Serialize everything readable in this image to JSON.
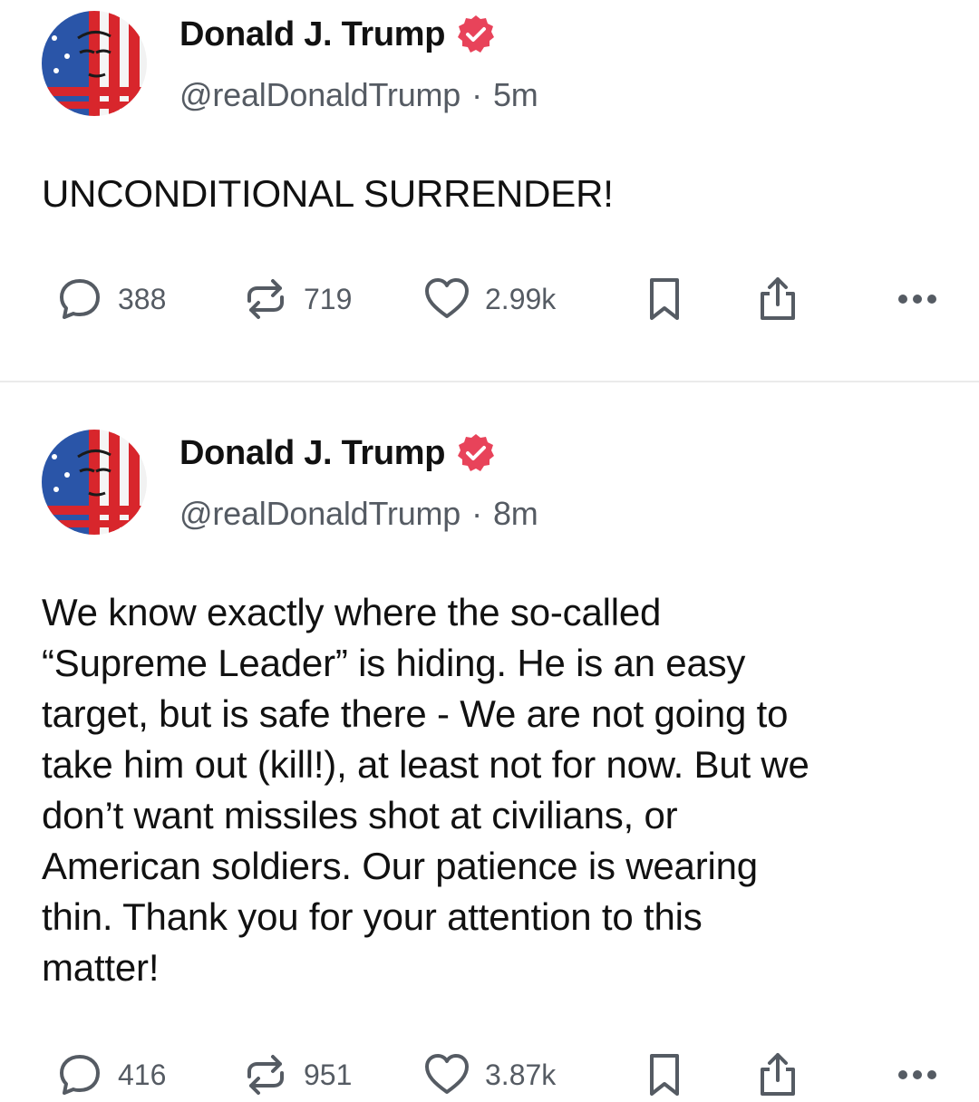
{
  "posts": [
    {
      "author": {
        "name": "Donald J. Trump",
        "handle": "@realDonaldTrump",
        "verified": true,
        "avatar_icon": "flag-portrait-avatar"
      },
      "time_separator": "·",
      "time": "5m",
      "text": "UNCONDITIONAL SURRENDER!",
      "stats": {
        "replies": "388",
        "retruths": "719",
        "likes": "2.99k"
      }
    },
    {
      "author": {
        "name": "Donald J. Trump",
        "handle": "@realDonaldTrump",
        "verified": true,
        "avatar_icon": "flag-portrait-avatar"
      },
      "time_separator": "·",
      "time": "8m",
      "text": "We know exactly where the so-called\n“Supreme Leader” is hiding. He is an easy\ntarget, but is safe there - We are not going to\ntake him out (kill!), at least not for now. But we\ndon’t want missiles shot at civilians, or\nAmerican soldiers. Our patience is wearing\nthin. Thank you for your attention to this\nmatter!",
      "stats": {
        "replies": "416",
        "retruths": "951",
        "likes": "3.87k"
      }
    }
  ],
  "icons": {
    "reply": "speech-bubble-icon",
    "retruth": "repost-arrows-icon",
    "like": "heart-icon",
    "save": "bookmark-icon",
    "share": "share-upload-icon",
    "more": "more-dots-icon",
    "verified": "verified-badge-icon"
  },
  "colors": {
    "text": "#111111",
    "secondary": "#555b63",
    "verified_badge": "#e8435a",
    "divider": "#ebebeb",
    "background": "#ffffff"
  }
}
